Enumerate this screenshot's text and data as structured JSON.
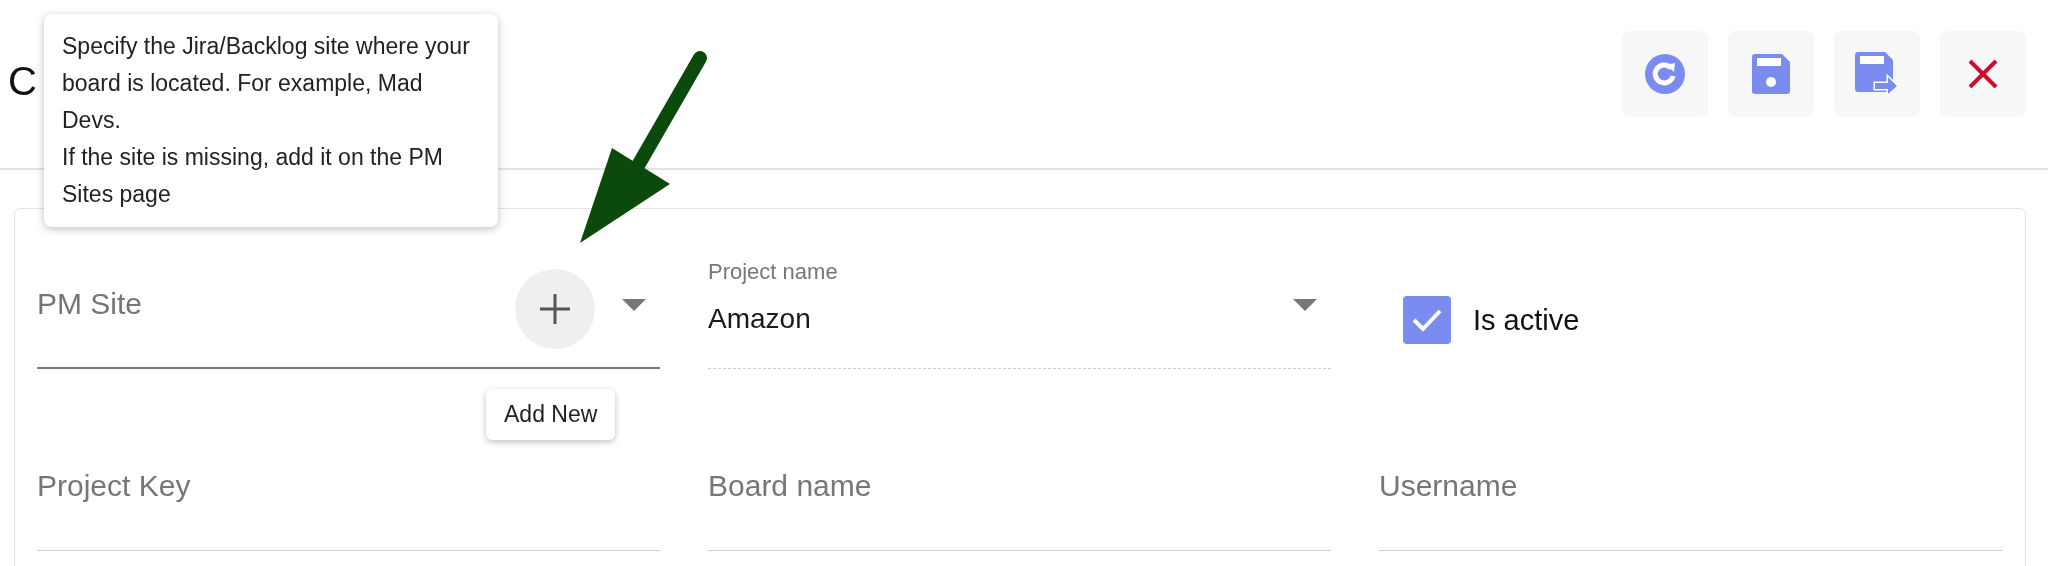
{
  "page": {
    "title": "C"
  },
  "toolbar": [
    {
      "kind": "refresh"
    },
    {
      "kind": "save"
    },
    {
      "kind": "save_as"
    },
    {
      "kind": "close"
    }
  ],
  "help_tooltip": {
    "paragraphs": [
      "Specify the Jira/Backlog site where your board is located. For example, Mad Devs.",
      "If the site is missing, add it on the PM Sites page"
    ]
  },
  "form": {
    "rows": [
      [
        {
          "kind": "select",
          "label": "PM Site",
          "add_tooltip": "Add New"
        },
        {
          "kind": "select",
          "label": "Project name",
          "value": "Amazon"
        },
        {
          "kind": "checkbox",
          "label": "Is active",
          "checked": true
        }
      ],
      [
        {
          "kind": "text",
          "label": "Project Key"
        },
        {
          "kind": "text",
          "label": "Board name"
        },
        {
          "kind": "text",
          "label": "Username"
        }
      ]
    ]
  }
}
